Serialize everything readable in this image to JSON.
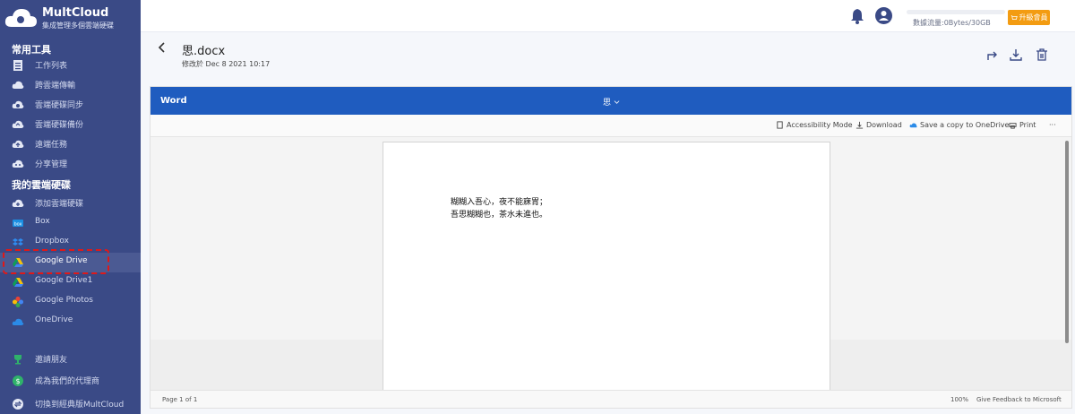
{
  "app": {
    "name": "MultCloud",
    "tagline": "集成管理多個雲端硬碟"
  },
  "sidebar": {
    "section_common": "常用工具",
    "common_items": [
      {
        "label": "工作列表",
        "icon": "task-list-icon"
      },
      {
        "label": "跨雲端傳輸",
        "icon": "cloud-transfer-icon"
      },
      {
        "label": "雲端硬碟同步",
        "icon": "cloud-sync-icon"
      },
      {
        "label": "雲端硬碟備份",
        "icon": "cloud-backup-icon"
      },
      {
        "label": "遠端任務",
        "icon": "remote-upload-icon"
      },
      {
        "label": "分享管理",
        "icon": "share-icon"
      }
    ],
    "section_drives": "我的雲端硬碟",
    "drive_items": [
      {
        "label": "添加雲端硬碟",
        "icon": "add-cloud-icon"
      },
      {
        "label": "Box",
        "icon": "box-icon"
      },
      {
        "label": "Dropbox",
        "icon": "dropbox-icon"
      },
      {
        "label": "Google Drive",
        "icon": "google-drive-icon"
      },
      {
        "label": "Google Drive1",
        "icon": "google-drive-icon"
      },
      {
        "label": "Google Photos",
        "icon": "google-photos-icon"
      },
      {
        "label": "OneDrive",
        "icon": "onedrive-icon"
      }
    ],
    "bottom_items": [
      {
        "label": "邀請朋友",
        "icon": "trophy-icon"
      },
      {
        "label": "成為我們的代理商",
        "icon": "dollar-icon"
      },
      {
        "label": "切換到經典版MultCloud",
        "icon": "switch-icon"
      }
    ]
  },
  "header": {
    "usage_text": "數據流量:0Bytes/30GB",
    "upgrade_label": "升級會員"
  },
  "file": {
    "title": "思.docx",
    "modified": "修改於 Dec 8 2021 10:17"
  },
  "viewer": {
    "brand": "Word",
    "doc_name": "思",
    "commands": {
      "accessibility": "Accessibility Mode",
      "download": "Download",
      "save_onedrive": "Save a copy to OneDrive.",
      "print": "Print",
      "more": "···"
    },
    "content_lines": [
      "糊糊入吾心，夜不能寐胃；",
      "吾思糊糊也，茶水未進也。"
    ],
    "status_page": "Page 1 of 1",
    "status_zoom": "100%",
    "status_feedback": "Give Feedback to Microsoft"
  },
  "colors": {
    "sidebar_bg": "#3a4a86",
    "word_blue": "#1f5cbf",
    "upgrade_orange": "#f39c12",
    "highlight_red": "#e01818"
  }
}
